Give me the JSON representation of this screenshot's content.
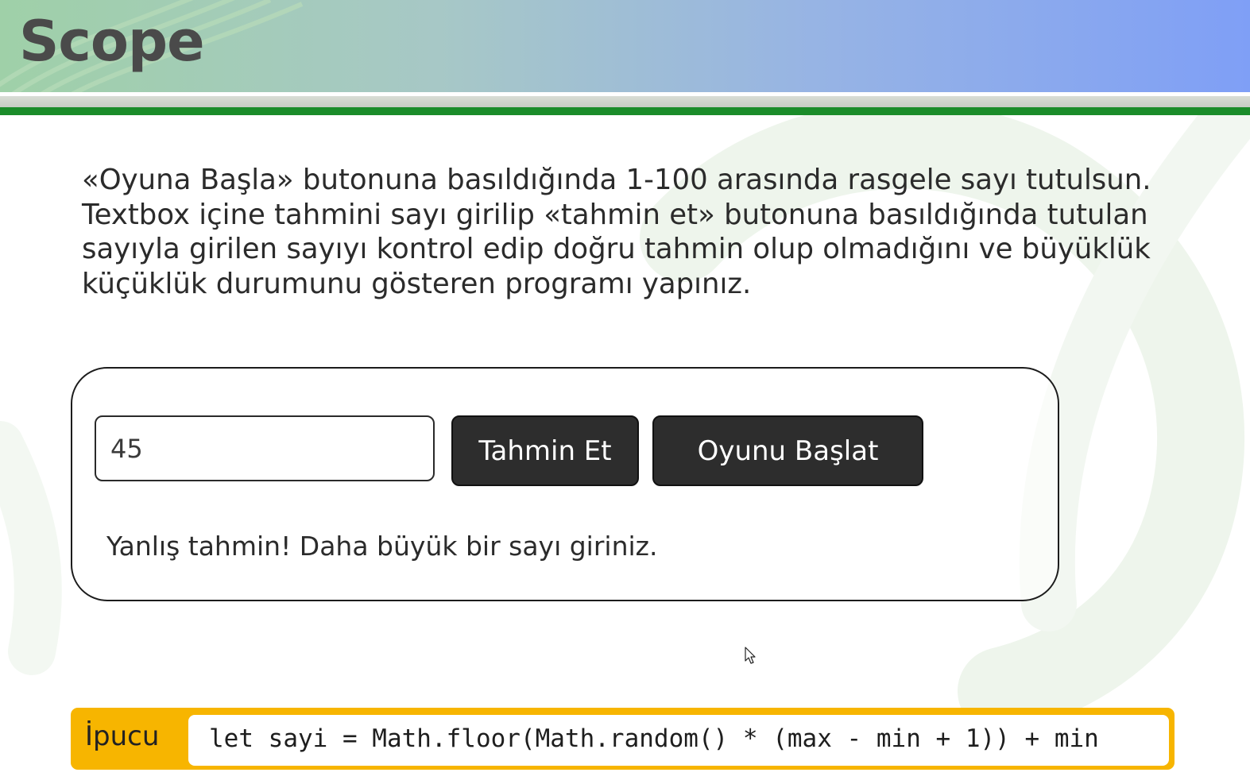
{
  "header": {
    "title": "Scope"
  },
  "task": {
    "text": "«Oyuna Başla» butonuna basıldığında 1-100 arasında rasgele sayı tutulsun. Textbox içine tahmini sayı girilip «tahmin et» butonuna basıldığında tutulan sayıyla girilen sayıyı kontrol edip  doğru tahmin olup olmadığını ve büyüklük küçüklük durumunu gösteren programı yapınız."
  },
  "game": {
    "input_value": "45",
    "guess_button_label": "Tahmin Et",
    "start_button_label": "Oyunu Başlat",
    "result_message": "Yanlış tahmin! Daha büyük bir sayı giriniz."
  },
  "hint": {
    "label": "İpucu",
    "code": "let sayi = Math.floor(Math.random() * (max - min + 1)) + min"
  },
  "colors": {
    "header_gradient_start": "#9fd0a8",
    "header_gradient_end": "#7f9ff6",
    "accent_green": "#1b8c2a",
    "button_dark": "#2d2d2d",
    "hint_yellow": "#f7b500"
  },
  "icons": {
    "cursor": "mouse-pointer-icon"
  }
}
